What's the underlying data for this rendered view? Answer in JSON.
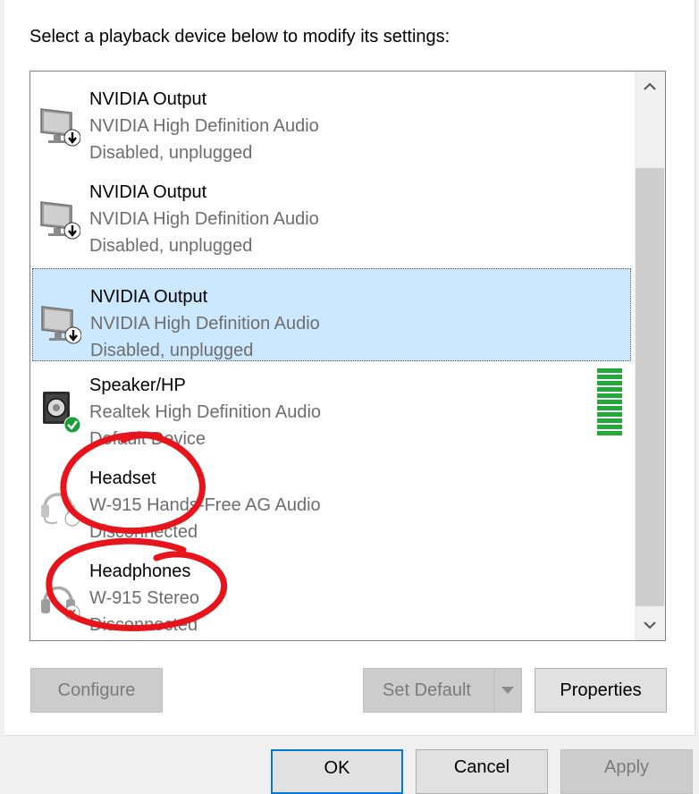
{
  "instruction": "Select a playback device below to modify its settings:",
  "devices": [
    {
      "name": "NVIDIA Output",
      "driver": "NVIDIA High Definition Audio",
      "status": "Disabled, unplugged"
    },
    {
      "name": "NVIDIA Output",
      "driver": "NVIDIA High Definition Audio",
      "status": "Disabled, unplugged"
    },
    {
      "name": "NVIDIA Output",
      "driver": "NVIDIA High Definition Audio",
      "status": "Disabled, unplugged"
    },
    {
      "name": "Speaker/HP",
      "driver": "Realtek High Definition Audio",
      "status": "Default Device"
    },
    {
      "name": "Headset",
      "driver": "W-915 Hands-Free AG Audio",
      "status": "Disconnected"
    },
    {
      "name": "Headphones",
      "driver": "W-915 Stereo",
      "status": "Disconnected"
    }
  ],
  "selected_index": 2,
  "buttons": {
    "configure": "Configure",
    "set_default": "Set Default",
    "properties": "Properties",
    "ok": "OK",
    "cancel": "Cancel",
    "apply": "Apply"
  },
  "icons": {
    "monitor": "monitor-speaker-icon",
    "speaker": "speaker-icon",
    "headset": "headset-icon",
    "headphones": "headphones-icon"
  },
  "colors": {
    "selection": "#cce8ff",
    "level": "#23a83a",
    "annotation": "#e8141b",
    "default_check": "#1a9e3a"
  }
}
